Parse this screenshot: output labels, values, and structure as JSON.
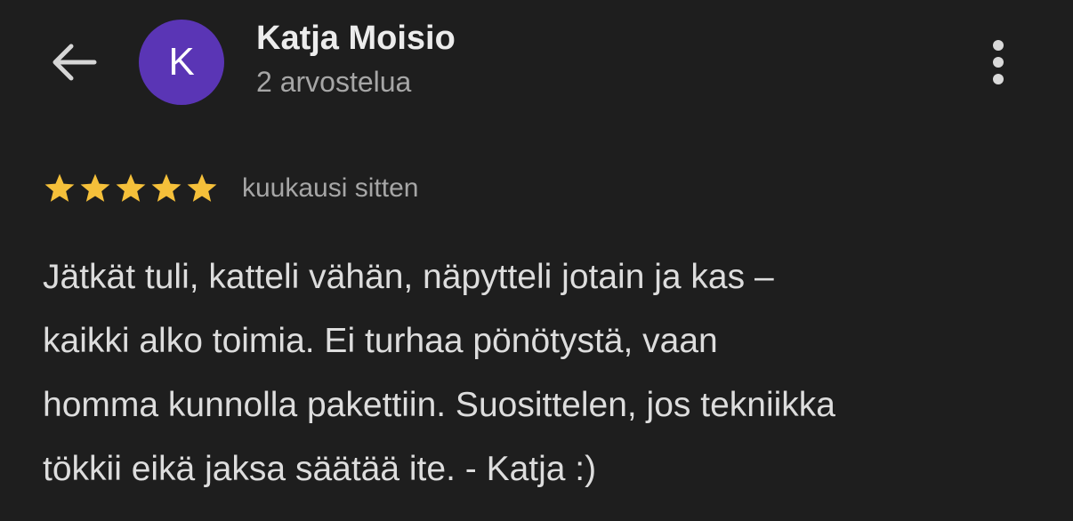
{
  "header": {
    "back_icon": "arrow-left-icon",
    "avatar_letter": "K",
    "avatar_color": "#5a35b5",
    "reviewer_name": "Katja Moisio",
    "review_count": "2 arvostelua",
    "more_icon": "more-vertical-icon"
  },
  "review": {
    "rating": 5,
    "max_rating": 5,
    "star_color": "#f5c03a",
    "date": "kuukausi sitten",
    "lines": [
      "Jätkät tuli, katteli vähän, näpytteli jotain ja kas –",
      "kaikki alko toimia. Ei turhaa pönötystä, vaan",
      "homma kunnolla pakettiin. Suosittelen, jos tekniikka",
      "tökkii eikä jaksa säätää ite. - Katja :)"
    ]
  }
}
